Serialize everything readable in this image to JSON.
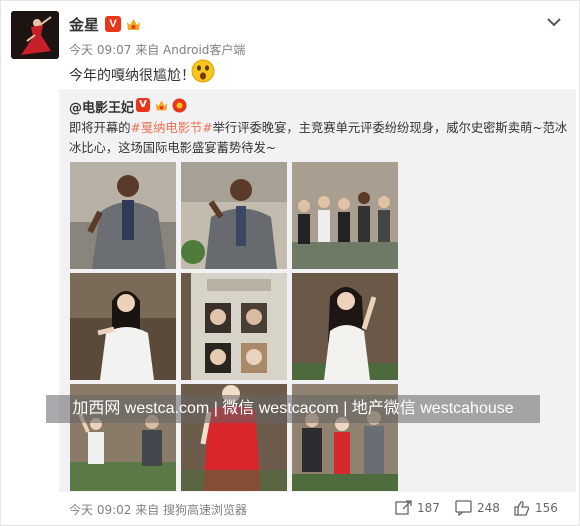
{
  "post": {
    "username": "金星",
    "v_badge": "V",
    "meta": "今天 09:07 来自 Android客户端",
    "text": "今年的嘎纳很尴尬！"
  },
  "repost": {
    "username": "@电影王妃",
    "v_badge": "V",
    "text_prefix": "即将开幕的",
    "topic": "#戛纳电影节#",
    "text_suffix": "举行评委晚宴，主竞赛单元评委纷纷现身，威尔史密斯卖萌~范冰冰比心，这场国际电影盛宴蓄势待发~",
    "meta": "今天 09:02 来自 搜狗高速浏览器",
    "forward_count": "187",
    "comment_count": "248",
    "like_count": "156"
  },
  "watermark": "加西网 westca.com | 微信 westcacom | 地产微信 westcahouse",
  "colors": {
    "topic": "#eb7350",
    "v_badge": "#e8361b",
    "repost_bg": "#f2f2f5"
  },
  "icons": [
    "chevron-down-icon",
    "forward-icon",
    "comment-icon",
    "like-icon",
    "surprised-emoji-icon",
    "vip-crown-icon"
  ]
}
